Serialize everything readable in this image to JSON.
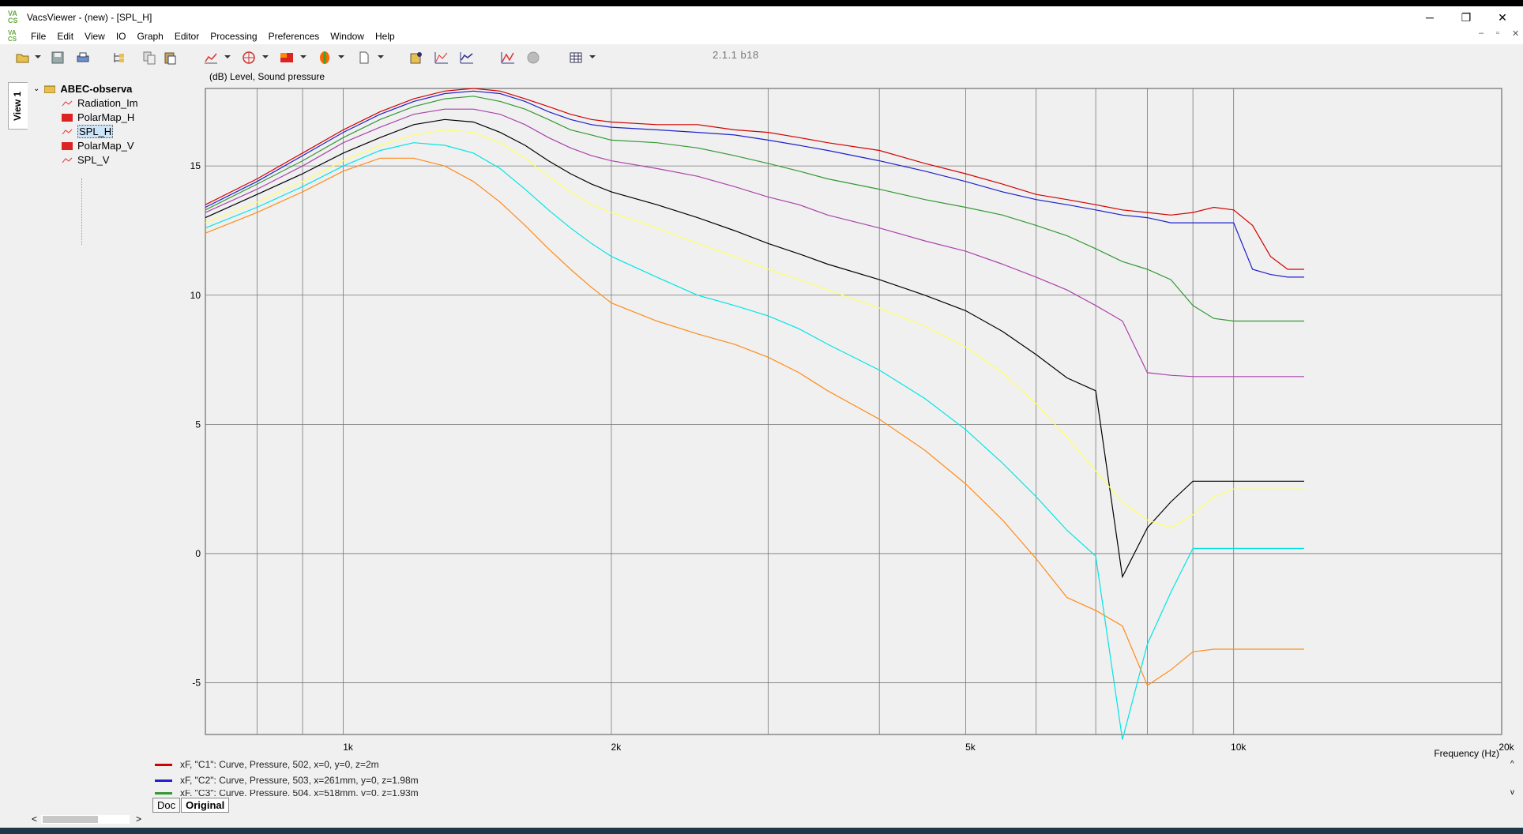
{
  "window": {
    "title": "VacsViewer - (new) - [SPL_H]",
    "app_icon_text": "VA CS",
    "minimize": "─",
    "restore": "❐",
    "close": "✕"
  },
  "menu": [
    "File",
    "Edit",
    "View",
    "IO",
    "Graph",
    "Editor",
    "Processing",
    "Preferences",
    "Window",
    "Help"
  ],
  "mdi_controls": [
    "–",
    "▫",
    "✕"
  ],
  "toolbar": {
    "version": "2.1.1 b18",
    "icons": [
      "open-icon",
      "save-icon",
      "print-icon",
      "tree-icon",
      "copy-icon",
      "paste-icon",
      "line-graph-icon",
      "polar-icon",
      "colormap-icon",
      "balloon-icon",
      "page-icon",
      "script-icon",
      "window-icon",
      "fft-icon",
      "chart-icon",
      "stop-icon",
      "grid-icon"
    ]
  },
  "view_tab": "View 1",
  "tree": {
    "root": "ABEC-observa",
    "items": [
      {
        "label": "Radiation_Im",
        "icon": "graph-icon"
      },
      {
        "label": "PolarMap_H",
        "icon": "colormap-icon"
      },
      {
        "label": "SPL_H",
        "icon": "graph-icon",
        "selected": true
      },
      {
        "label": "PolarMap_V",
        "icon": "colormap-icon"
      },
      {
        "label": "SPL_V",
        "icon": "graph-icon"
      }
    ]
  },
  "chart_data": {
    "type": "line",
    "ylabel": "(dB)  Level, Sound pressure",
    "xlabel": "Frequency  (Hz)",
    "xscale": "log",
    "xlim": [
      700,
      20000
    ],
    "ylim": [
      -7,
      18
    ],
    "grid": true,
    "x_ticks": [
      1000,
      2000,
      5000,
      10000,
      20000
    ],
    "x_tick_labels": [
      "1k",
      "2k",
      "5k",
      "10k",
      "20k"
    ],
    "y_ticks": [
      -5,
      0,
      5,
      10,
      15
    ],
    "y_tick_labels": [
      "-5",
      "0",
      "5",
      "10",
      "15"
    ],
    "x": [
      700,
      800,
      900,
      1000,
      1100,
      1200,
      1300,
      1400,
      1500,
      1600,
      1700,
      1800,
      1900,
      2000,
      2250,
      2500,
      2750,
      3000,
      3250,
      3500,
      4000,
      4500,
      5000,
      5500,
      6000,
      6500,
      7000,
      7500,
      8000,
      8500,
      9000,
      9500,
      10000,
      10500,
      11000,
      11500,
      12000
    ],
    "series": [
      {
        "color": "#d40000",
        "values": [
          13.5,
          14.5,
          15.5,
          16.4,
          17.1,
          17.6,
          17.9,
          18.0,
          17.9,
          17.6,
          17.3,
          17.0,
          16.8,
          16.7,
          16.6,
          16.6,
          16.4,
          16.3,
          16.1,
          15.9,
          15.6,
          15.1,
          14.7,
          14.3,
          13.9,
          13.7,
          13.5,
          13.3,
          13.2,
          13.1,
          13.2,
          13.4,
          13.3,
          12.7,
          11.5,
          11.0,
          11.0
        ]
      },
      {
        "color": "#2020cc",
        "values": [
          13.4,
          14.4,
          15.4,
          16.3,
          17.0,
          17.5,
          17.8,
          17.9,
          17.8,
          17.5,
          17.1,
          16.8,
          16.6,
          16.5,
          16.4,
          16.3,
          16.2,
          16.0,
          15.8,
          15.6,
          15.2,
          14.8,
          14.4,
          14.0,
          13.7,
          13.5,
          13.3,
          13.1,
          13.0,
          12.8,
          12.8,
          12.8,
          12.8,
          11.0,
          10.8,
          10.7,
          10.7
        ]
      },
      {
        "color": "#339933",
        "values": [
          13.3,
          14.3,
          15.2,
          16.1,
          16.8,
          17.3,
          17.6,
          17.7,
          17.5,
          17.2,
          16.8,
          16.4,
          16.2,
          16.0,
          15.9,
          15.7,
          15.4,
          15.1,
          14.8,
          14.5,
          14.1,
          13.7,
          13.4,
          13.1,
          12.7,
          12.3,
          11.8,
          11.3,
          11.0,
          10.6,
          9.6,
          9.1,
          9.0,
          9.0,
          9.0,
          9.0,
          9.0
        ]
      },
      {
        "color": "#aa44aa",
        "values": [
          13.2,
          14.1,
          15.0,
          15.9,
          16.5,
          17.0,
          17.2,
          17.2,
          17.0,
          16.6,
          16.1,
          15.7,
          15.4,
          15.2,
          14.9,
          14.6,
          14.2,
          13.8,
          13.5,
          13.1,
          12.6,
          12.1,
          11.7,
          11.2,
          10.7,
          10.2,
          9.6,
          9.0,
          7.0,
          6.9,
          6.85,
          6.85,
          6.85,
          6.85,
          6.85,
          6.85,
          6.85
        ]
      },
      {
        "color": "#000000",
        "values": [
          13.0,
          13.9,
          14.7,
          15.5,
          16.1,
          16.6,
          16.8,
          16.7,
          16.3,
          15.8,
          15.2,
          14.7,
          14.3,
          14.0,
          13.5,
          13.0,
          12.5,
          12.0,
          11.6,
          11.2,
          10.6,
          10.0,
          9.4,
          8.6,
          7.7,
          6.8,
          6.3,
          -0.9,
          1.0,
          2.0,
          2.8,
          2.8,
          2.8,
          2.8,
          2.8,
          2.8,
          2.8
        ]
      },
      {
        "color": "#ffff66",
        "values": [
          12.8,
          13.6,
          14.4,
          15.2,
          15.8,
          16.2,
          16.4,
          16.3,
          15.9,
          15.3,
          14.6,
          14.0,
          13.5,
          13.2,
          12.6,
          12.0,
          11.5,
          11.0,
          10.6,
          10.2,
          9.5,
          8.8,
          8.0,
          7.0,
          5.8,
          4.5,
          3.2,
          2.0,
          1.3,
          1.0,
          1.5,
          2.2,
          2.5,
          2.5,
          2.5,
          2.5,
          2.5
        ]
      },
      {
        "color": "#00e5e5",
        "values": [
          12.6,
          13.4,
          14.2,
          15.0,
          15.6,
          15.9,
          15.8,
          15.5,
          14.9,
          14.1,
          13.3,
          12.6,
          12.0,
          11.5,
          10.7,
          10.0,
          9.6,
          9.2,
          8.7,
          8.1,
          7.1,
          6.0,
          4.8,
          3.5,
          2.2,
          0.9,
          -0.1,
          -7.2,
          -3.5,
          -1.5,
          0.2,
          0.2,
          0.2,
          0.2,
          0.2,
          0.2,
          0.2
        ]
      },
      {
        "color": "#ff8c1a",
        "values": [
          12.4,
          13.2,
          14.0,
          14.8,
          15.3,
          15.3,
          15.0,
          14.4,
          13.6,
          12.7,
          11.8,
          11.0,
          10.3,
          9.7,
          9.0,
          8.5,
          8.1,
          7.6,
          7.0,
          6.3,
          5.2,
          4.0,
          2.7,
          1.3,
          -0.2,
          -1.7,
          -2.2,
          -2.8,
          -5.1,
          -4.5,
          -3.8,
          -3.7,
          -3.7,
          -3.7,
          -3.7,
          -3.7,
          -3.7
        ]
      }
    ]
  },
  "legend": [
    {
      "color": "#d40000",
      "label": "xF, \"C1\": Curve, Pressure, 502, x=0, y=0, z=2m"
    },
    {
      "color": "#2020cc",
      "label": "xF, \"C2\": Curve, Pressure, 503, x=261mm, y=0, z=1.98m"
    },
    {
      "color": "#339933",
      "label": "xF, \"C3\": Curve, Pressure, 504, x=518mm, y=0, z=1.93m"
    }
  ],
  "bottom_tabs": [
    "Doc",
    "Original"
  ],
  "scrollbar": {
    "left": "<",
    "right": ">"
  }
}
